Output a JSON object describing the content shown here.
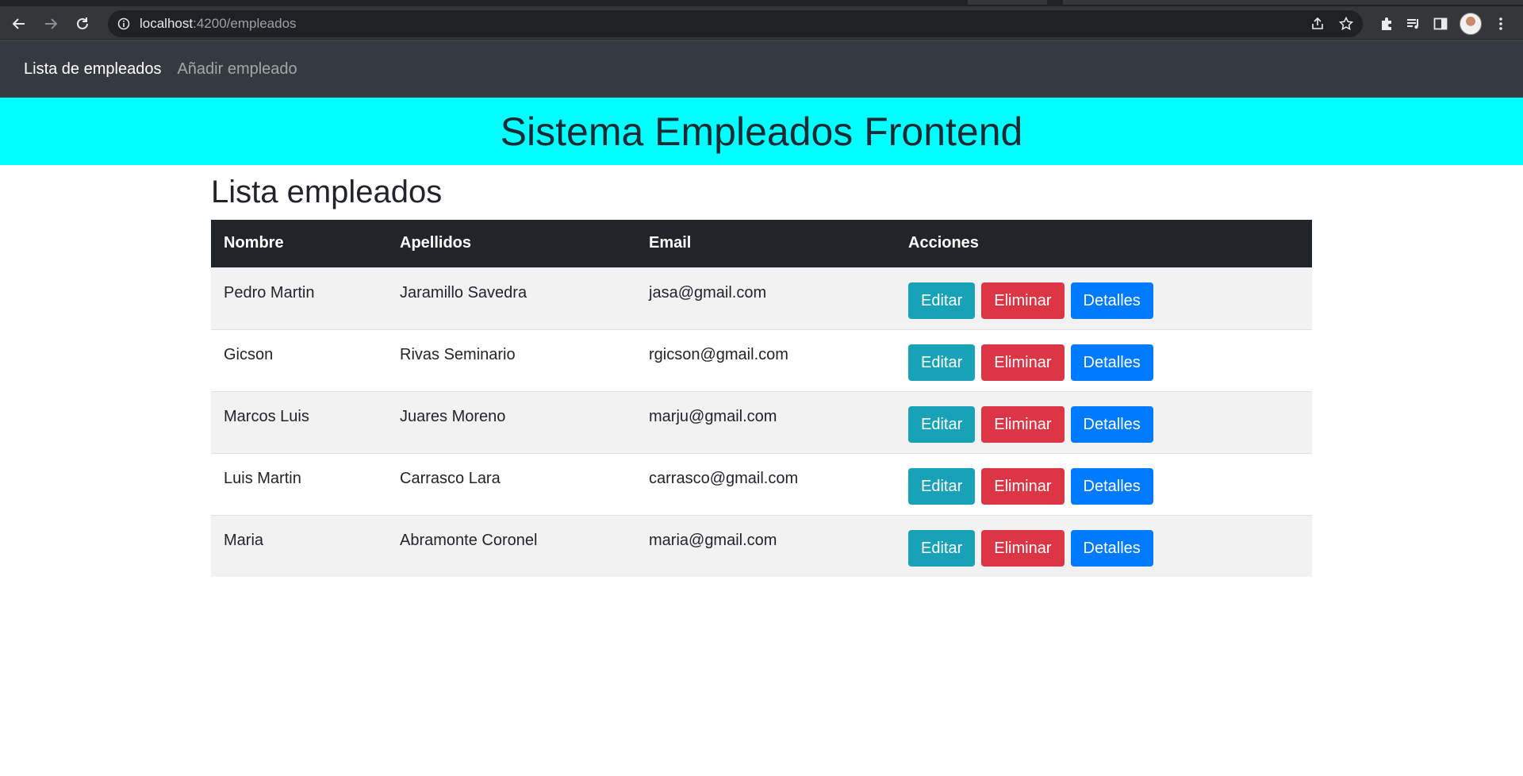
{
  "browser": {
    "url_host": "localhost",
    "url_path": ":4200/empleados"
  },
  "navbar": {
    "links": [
      {
        "label": "Lista de empleados"
      },
      {
        "label": "Añadir empleado"
      }
    ]
  },
  "banner": {
    "title": "Sistema Empleados Frontend"
  },
  "page": {
    "title": "Lista empleados"
  },
  "table": {
    "headers": [
      "Nombre",
      "Apellidos",
      "Email",
      "Acciones"
    ],
    "rows": [
      {
        "nombre": "Pedro Martin",
        "apellidos": "Jaramillo Savedra",
        "email": "jasa@gmail.com"
      },
      {
        "nombre": "Gicson",
        "apellidos": "Rivas Seminario",
        "email": "rgicson@gmail.com"
      },
      {
        "nombre": "Marcos Luis",
        "apellidos": "Juares Moreno",
        "email": "marju@gmail.com"
      },
      {
        "nombre": "Luis Martin",
        "apellidos": "Carrasco Lara",
        "email": "carrasco@gmail.com"
      },
      {
        "nombre": "Maria",
        "apellidos": "Abramonte Coronel",
        "email": "maria@gmail.com"
      }
    ],
    "actions": {
      "edit": "Editar",
      "delete": "Eliminar",
      "details": "Detalles"
    }
  },
  "colors": {
    "banner": "#00ffff",
    "navbar": "#343a40",
    "btn_edit": "#17a2b8",
    "btn_delete": "#dc3545",
    "btn_details": "#007bff"
  }
}
